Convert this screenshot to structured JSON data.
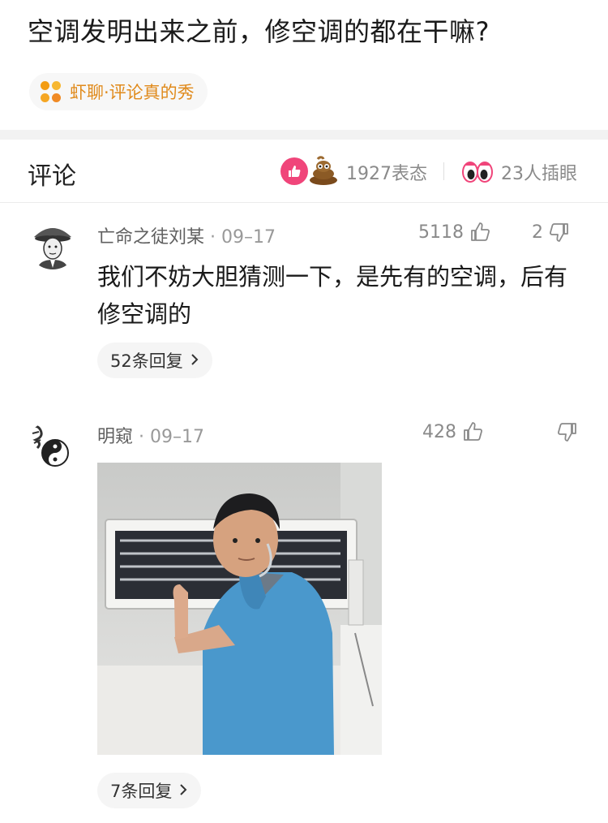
{
  "question": {
    "title": "空调发明出来之前，修空调的都在干嘛?",
    "channel": "虾聊·评论真的秀"
  },
  "comments_header": {
    "heading": "评论",
    "reaction_count": "1927表态",
    "eyes_count": "23人插眼"
  },
  "comments": [
    {
      "author": "亡命之徒刘某",
      "date": "· 09–17",
      "likes": "5118",
      "dislikes": "2",
      "text": "我们不妨大胆猜测一下，是先有的空调，后有修空调的",
      "replies": "52条回复"
    },
    {
      "author": "明窥",
      "date": "· 09–17",
      "likes": "428",
      "dislikes": "",
      "replies": "7条回复"
    }
  ],
  "colors": {
    "channel_accent": "#e08a1b",
    "like_reaction": "#f0457a",
    "muted_text": "#8a8a8a"
  }
}
